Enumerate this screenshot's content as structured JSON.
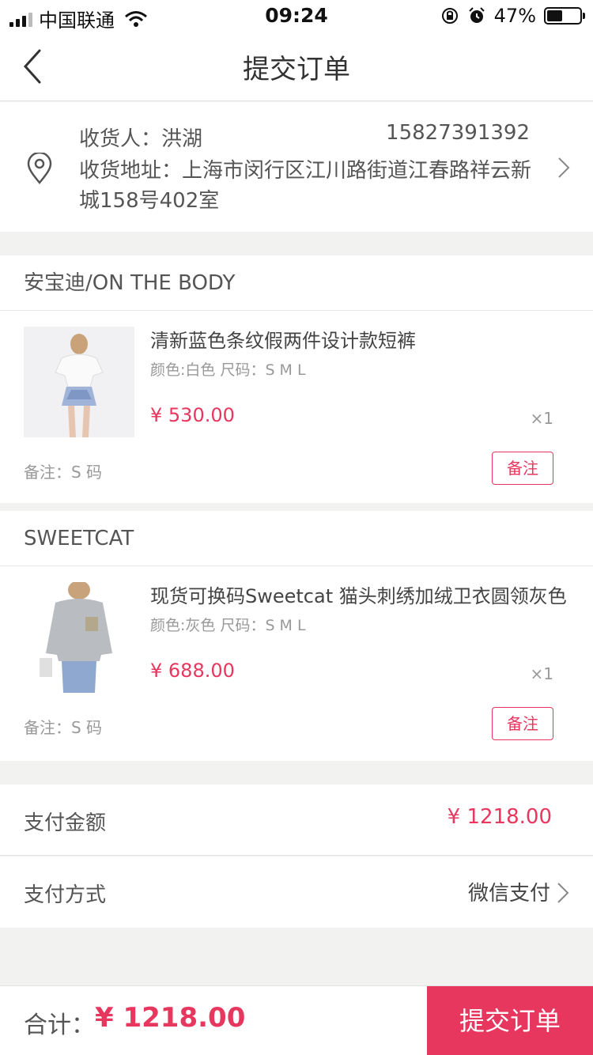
{
  "status_bar": {
    "carrier": "中国联通",
    "time": "09:24",
    "battery_percent": "47%"
  },
  "header": {
    "title": "提交订单"
  },
  "address": {
    "receiver": "收货人：洪湖",
    "phone": "15827391392",
    "full_address": "收货地址：上海市闵行区江川路街道江春路祥云新城158号402室"
  },
  "shops": [
    {
      "name": "安宝迪/ON THE BODY",
      "product_name": "清新蓝色条纹假两件设计款短裤",
      "spec": "颜色:白色   尺码：S  M  L",
      "price": "¥ 530.00",
      "quantity": "×1",
      "note": "备注：S 码",
      "note_button": "备注"
    },
    {
      "name": "SWEETCAT",
      "product_name": "现货可换码Sweetcat 猫头刺绣加绒卫衣圆领灰色",
      "spec": "颜色:灰色   尺码：S  M  L",
      "price": "¥ 688.00",
      "quantity": "×1",
      "note": "备注：S 码",
      "note_button": "备注"
    }
  ],
  "payment": {
    "amount_label": "支付金额",
    "amount_value": "¥ 1218.00",
    "method_label": "支付方式",
    "method_value": "微信支付"
  },
  "footer": {
    "total_label": "合计：",
    "total_value": "¥ 1218.00",
    "submit_label": "提交订单"
  },
  "colors": {
    "accent": "#e8375f",
    "background": "#f2f2f0"
  }
}
